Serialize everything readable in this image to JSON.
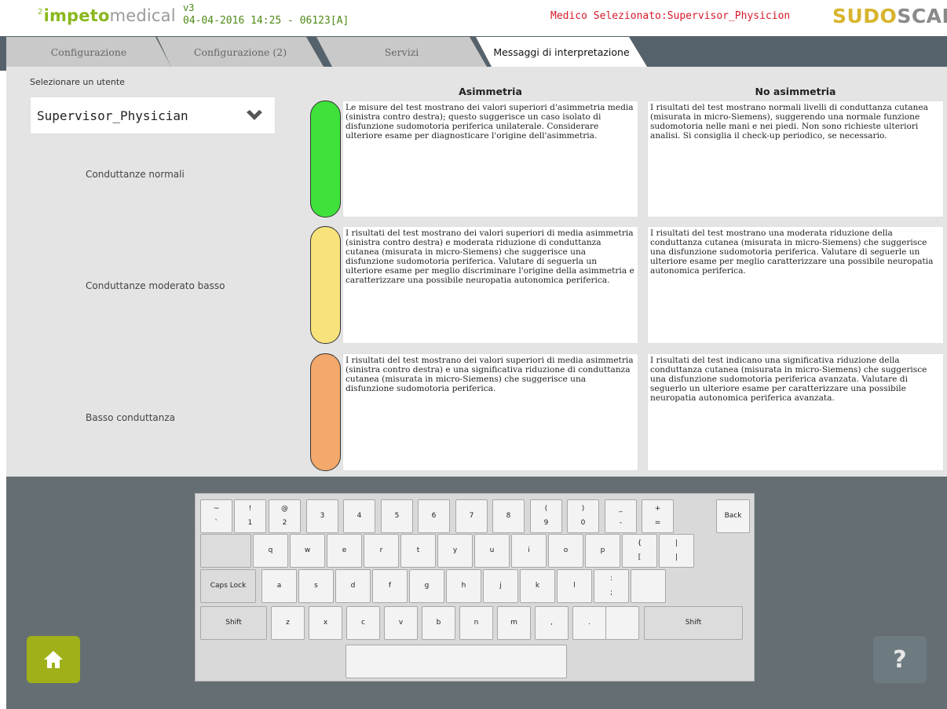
{
  "header": {
    "logo_sup": "2",
    "logo_a": "impeto",
    "logo_b": "medical",
    "version": "v3",
    "datetime": "04-04-2016 14:25 - 06123[A]",
    "physician": "Medico Selezionato:Supervisor_Physicion",
    "brand_a": "SUDO",
    "brand_b": "SCAN"
  },
  "tabs": [
    {
      "label": "Configurazione",
      "active": false
    },
    {
      "label": "Configurazione (2)",
      "active": false
    },
    {
      "label": "Servizi",
      "active": false
    },
    {
      "label": "Messaggi di interpretazione",
      "active": true
    }
  ],
  "user": {
    "label": "Selezionare un utente",
    "selected": "Supervisor_Physician"
  },
  "columns": {
    "asym": "Asimmetria",
    "noasym": "No asimmetria"
  },
  "rows": [
    {
      "label": "Conduttanze normali",
      "color": "#3ee23a",
      "asym": "Le misure del test mostrano dei valori superiori d'asimmetria media (sinistra contro destra); questo suggerisce un caso isolato di disfunzione sudomotoria periferica unilaterale. Considerare ulteriore esame per diagnosticare l'origine dell'asimmetria.",
      "noasym": "I risultati del test mostrano normali livelli di conduttanza cutanea (misurata in micro-Siemens), suggerendo una normale funzione sudomotoria nelle mani e nei piedi. Non sono richieste ulteriori analisi. Si consiglia il check-up periodico, se necessario."
    },
    {
      "label": "Conduttanze moderato basso",
      "color": "#f7e27c",
      "asym": "I risultati del test mostrano dei valori superiori di media asimmetria (sinistra contro destra) e moderata riduzione di conduttanza cutanea (misurata in micro-Siemens) che suggerisce una disfunzione sudomotoria periferica. Valutare di seguerla un ulteriore esame per meglio discriminare l'origine della asimmetria e caratterizzare una possibile neuropatia autonomica periferica.",
      "noasym": "I risultati del test mostrano una moderata riduzione della conduttanza cutanea (misurata in micro-Siemens) che suggerisce una disfunzione sudomotoria periferica. Valutare di seguerle un ulteriore esame per meglio caratterizzare una possibile neuropatia autonomica periferica."
    },
    {
      "label": "Basso conduttanza",
      "color": "#f3a86c",
      "asym": "I risultati del test mostrano dei valori superiori di media asimmetria (sinistra contro destra) e una significativa riduzione di conduttanza cutanea (misurata in micro-Siemens) che suggerisce una disfunzione sudomotoria periferica.",
      "noasym": "I risultati del test indicano una significativa riduzione della conduttanza cutanea (misurata in micro-Siemens) che suggerisce una disfunzione sudomotoria periferica avanzata. Valutare di seguerlo un ulteriore esame per caratterizzare una possibile neuropatia autonomica periferica avanzata."
    }
  ],
  "keyboard": {
    "row1": [
      {
        "up": "~",
        "lo": "`"
      },
      {
        "up": "!",
        "lo": "1"
      },
      {
        "up": "@",
        "lo": "2"
      },
      {
        "up": "",
        "lo": "3"
      },
      {
        "up": "",
        "lo": "4"
      },
      {
        "up": "",
        "lo": "5"
      },
      {
        "up": "",
        "lo": "6"
      },
      {
        "up": "",
        "lo": "7"
      },
      {
        "up": "",
        "lo": "8"
      },
      {
        "up": "(",
        "lo": "9"
      },
      {
        "up": ")",
        "lo": "0"
      },
      {
        "up": "_",
        "lo": "-"
      },
      {
        "up": "+",
        "lo": "="
      }
    ],
    "back": "Back",
    "row2": [
      "q",
      "w",
      "e",
      "r",
      "t",
      "y",
      "u",
      "i",
      "o",
      "p"
    ],
    "row2_extra": [
      {
        "up": "{",
        "lo": "["
      },
      {
        "up": "|",
        "lo": "|"
      }
    ],
    "caps": "Caps Lock",
    "row3": [
      "a",
      "s",
      "d",
      "f",
      "g",
      "h",
      "j",
      "k",
      "l"
    ],
    "row3_extra": {
      "up": ":",
      "lo": ";"
    },
    "shift": "Shift",
    "row4": [
      "z",
      "x",
      "c",
      "v",
      "b",
      "n",
      "m",
      ",",
      "."
    ]
  },
  "help": "?"
}
